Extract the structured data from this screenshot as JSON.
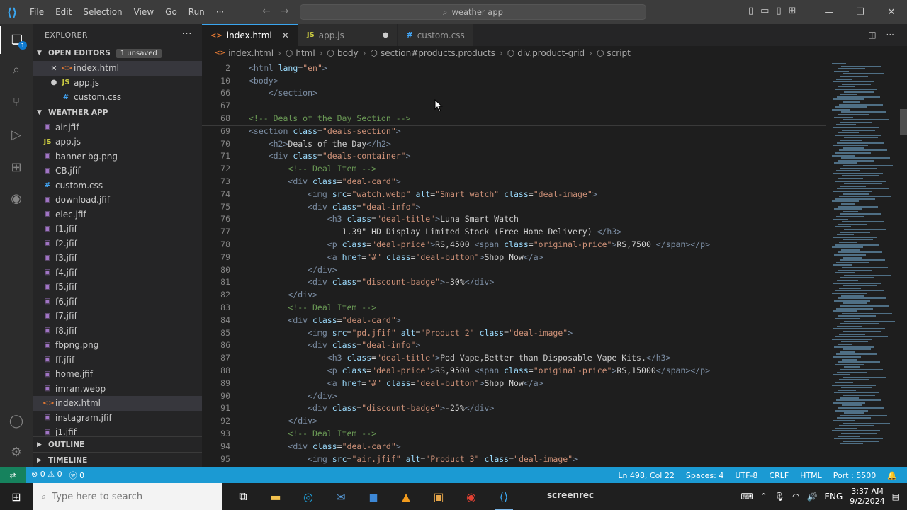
{
  "titlebar": {
    "menu": [
      "File",
      "Edit",
      "Selection",
      "View",
      "Go",
      "Run",
      "···"
    ],
    "search": "weather app"
  },
  "sidebar": {
    "title": "EXPLORER",
    "open_editors": {
      "label": "OPEN EDITORS",
      "badge": "1 unsaved",
      "items": [
        {
          "name": "index.html",
          "icon": "html-file-icon"
        },
        {
          "name": "app.js",
          "icon": "js-file-icon"
        },
        {
          "name": "custom.css",
          "icon": "css-file-icon"
        }
      ]
    },
    "folder": {
      "label": "WEATHER APP",
      "files": [
        "air.jfif",
        "app.js",
        "banner-bg.png",
        "CB.jfif",
        "custom.css",
        "download.jfif",
        "elec.jfif",
        "f1.jfif",
        "f2.jfif",
        "f3.jfif",
        "f4.jfif",
        "f5.jfif",
        "f6.jfif",
        "f7.jfif",
        "f8.jfif",
        "fbpng.png",
        "ff.jfif",
        "home.jfif",
        "imran.webp",
        "index.html",
        "instagram.jfif",
        "j1.jfif"
      ]
    },
    "outline": "OUTLINE",
    "timeline": "TIMELINE"
  },
  "tabs": [
    {
      "label": "index.html",
      "prefix": "<>",
      "active": true
    },
    {
      "label": "app.js",
      "prefix": "JS",
      "active": false
    },
    {
      "label": "custom.css",
      "prefix": "#",
      "active": false
    }
  ],
  "breadcrumbs": [
    "index.html",
    "html",
    "body",
    "section#products.products",
    "div.product-grid",
    "script"
  ],
  "code": [
    {
      "n": "2",
      "t": "<html lang=\"en\">"
    },
    {
      "n": "10",
      "t": "<body>"
    },
    {
      "n": "66",
      "t": "    </section>"
    },
    {
      "n": "67",
      "t": ""
    },
    {
      "n": "68",
      "t": "<!-- Deals of the Day Section -->"
    },
    {
      "n": "69",
      "t": "<section class=\"deals-section\">"
    },
    {
      "n": "70",
      "t": "    <h2>Deals of the Day</h2>"
    },
    {
      "n": "71",
      "t": "    <div class=\"deals-container\">"
    },
    {
      "n": "72",
      "t": "        <!-- Deal Item -->"
    },
    {
      "n": "73",
      "t": "        <div class=\"deal-card\">"
    },
    {
      "n": "74",
      "t": "            <img src=\"watch.webp\" alt=\"Smart watch\" class=\"deal-image\">"
    },
    {
      "n": "75",
      "t": "            <div class=\"deal-info\">"
    },
    {
      "n": "76",
      "t": "                <h3 class=\"deal-title\">Luna Smart Watch"
    },
    {
      "n": "77",
      "t": "                   1.39\" HD Display Limited Stock (Free Home Delivery) </h3>"
    },
    {
      "n": "78",
      "t": "                <p class=\"deal-price\">RS,4500 <span class=\"original-price\">RS,7500 </span></p>"
    },
    {
      "n": "79",
      "t": "                <a href=\"#\" class=\"deal-button\">Shop Now</a>"
    },
    {
      "n": "80",
      "t": "            </div>"
    },
    {
      "n": "81",
      "t": "            <div class=\"discount-badge\">-30%</div>"
    },
    {
      "n": "82",
      "t": "        </div>"
    },
    {
      "n": "83",
      "t": "        <!-- Deal Item -->"
    },
    {
      "n": "84",
      "t": "        <div class=\"deal-card\">"
    },
    {
      "n": "85",
      "t": "            <img src=\"pd.jfif\" alt=\"Product 2\" class=\"deal-image\">"
    },
    {
      "n": "86",
      "t": "            <div class=\"deal-info\">"
    },
    {
      "n": "87",
      "t": "                <h3 class=\"deal-title\">Pod Vape,Better than Disposable Vape Kits.</h3>"
    },
    {
      "n": "88",
      "t": "                <p class=\"deal-price\">RS,9500 <span class=\"original-price\">RS,15000</span></p>"
    },
    {
      "n": "89",
      "t": "                <a href=\"#\" class=\"deal-button\">Shop Now</a>"
    },
    {
      "n": "90",
      "t": "            </div>"
    },
    {
      "n": "91",
      "t": "            <div class=\"discount-badge\">-25%</div>"
    },
    {
      "n": "92",
      "t": "        </div>"
    },
    {
      "n": "93",
      "t": "        <!-- Deal Item -->"
    },
    {
      "n": "94",
      "t": "        <div class=\"deal-card\">"
    },
    {
      "n": "95",
      "t": "            <img src=\"air.jfif\" alt=\"Product 3\" class=\"deal-image\">"
    }
  ],
  "statusbar": {
    "errors": "⊗ 0 ⚠ 0",
    "ports": "ⓦ 0",
    "position": "Ln 498, Col 22",
    "spaces": "Spaces: 4",
    "encoding": "UTF-8",
    "eol": "CRLF",
    "language": "HTML",
    "port": "Port : 5500"
  },
  "taskbar": {
    "search_placeholder": "Type here to search",
    "screenrec": "screenrec",
    "lang": "ENG",
    "time": "3:37 AM",
    "date": "9/2/2024"
  },
  "colors": {
    "accent": "#1b9ad3",
    "html": "#e37933",
    "js": "#cbcb41",
    "css": "#42a5f5"
  }
}
